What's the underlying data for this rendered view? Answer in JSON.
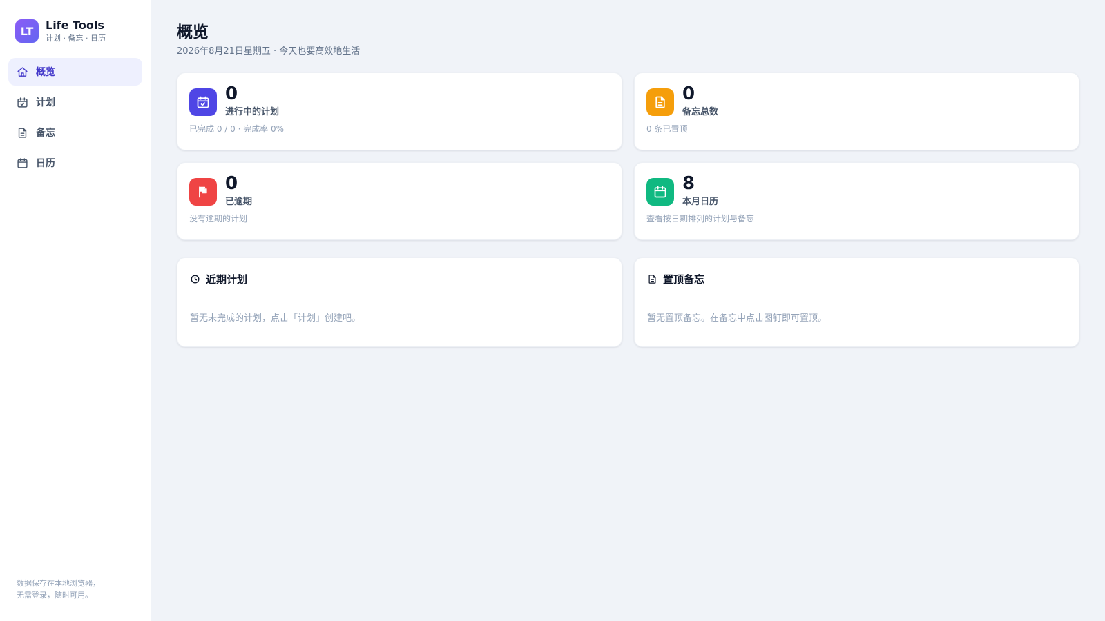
{
  "brand": {
    "logo_text": "LT",
    "title": "Life Tools",
    "subtitle": "计划 · 备忘 · 日历"
  },
  "sidebar": {
    "items": [
      {
        "label": "概览",
        "icon": "home-icon",
        "active": true
      },
      {
        "label": "计划",
        "icon": "calendar-check-icon",
        "active": false
      },
      {
        "label": "备忘",
        "icon": "document-icon",
        "active": false
      },
      {
        "label": "日历",
        "icon": "calendar-icon",
        "active": false
      }
    ],
    "footer_line1": "数据保存在本地浏览器，",
    "footer_line2": "无需登录，随时可用。"
  },
  "header": {
    "title": "概览",
    "subtitle": "2026年8月21日星期五 · 今天也要高效地生活"
  },
  "stats": [
    {
      "value": "0",
      "label": "进行中的计划",
      "desc": "已完成 0 / 0 · 完成率 0%",
      "icon": "calendar-check-icon",
      "color": "#4f46e5"
    },
    {
      "value": "0",
      "label": "备忘总数",
      "desc": "0 条已置顶",
      "icon": "document-icon",
      "color": "#f59e0b"
    },
    {
      "value": "0",
      "label": "已逾期",
      "desc": "没有逾期的计划",
      "icon": "flag-icon",
      "color": "#ef4444"
    },
    {
      "value": "8",
      "label": "本月日历",
      "desc": "查看按日期排列的计划与备忘",
      "icon": "calendar-icon",
      "color": "#10b981"
    }
  ],
  "panels": {
    "recent": {
      "title": "近期计划",
      "icon": "clock-icon",
      "empty": "暂无未完成的计划，点击「计划」创建吧。"
    },
    "pinned": {
      "title": "置顶备忘",
      "icon": "document-icon",
      "empty": "暂无置顶备忘。在备忘中点击图钉即可置顶。"
    }
  }
}
